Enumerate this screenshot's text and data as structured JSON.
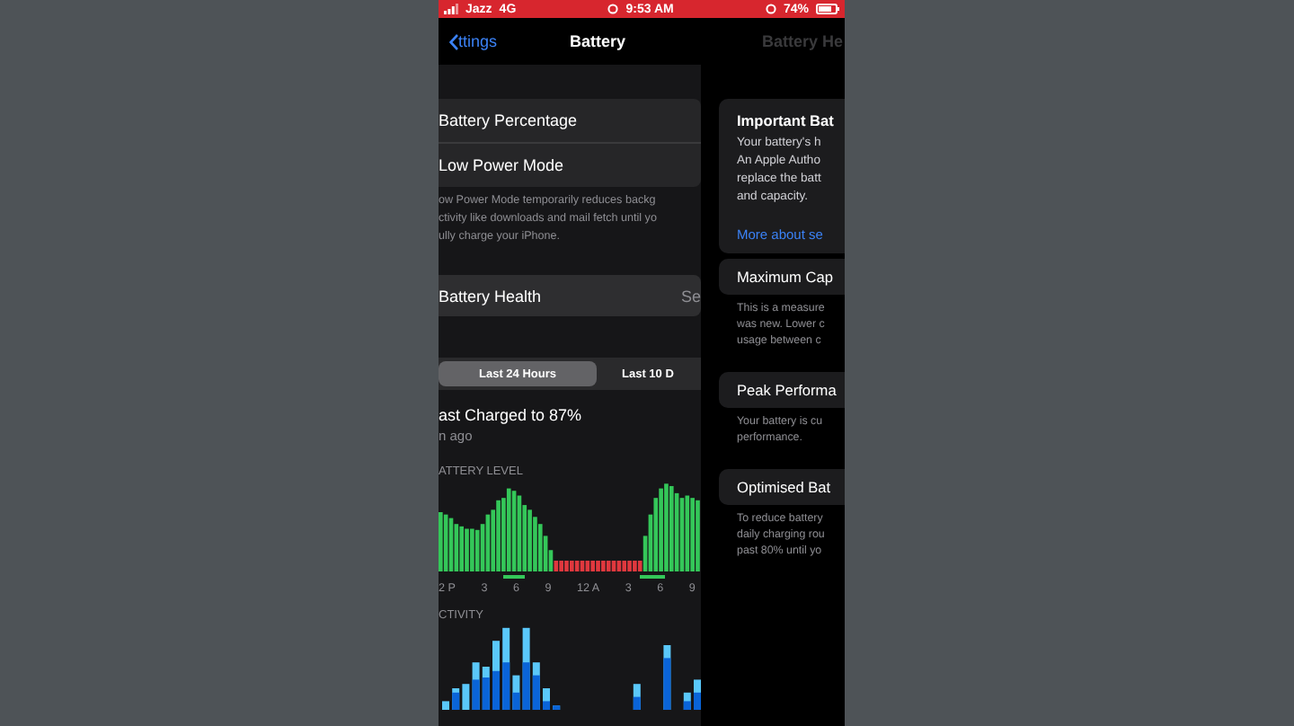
{
  "status_bar": {
    "carrier": "Jazz",
    "network": "4G",
    "time": "9:53 AM",
    "battery": "74%"
  },
  "nav": {
    "back": "ttings",
    "title": "Battery",
    "next_title": "Battery He"
  },
  "settings": [
    {
      "label": "Battery Percentage"
    },
    {
      "label": "Low Power Mode"
    }
  ],
  "low_power_note": "ow Power Mode temporarily reduces backg\nctivity like downloads and mail fetch until yo\nully charge your iPhone.",
  "battery_health": {
    "label": "Battery Health",
    "value": "Se"
  },
  "segments": [
    {
      "label": "Last 24 Hours",
      "selected": true
    },
    {
      "label": "Last 10 D",
      "selected": false
    }
  ],
  "last_charged": {
    "title": "ast Charged to 87%",
    "subtitle": "n ago"
  },
  "battery_level": {
    "heading": "ATTERY LEVEL",
    "x_labels": [
      "2 P",
      "3",
      "6",
      "9",
      "12 A",
      "3",
      "6",
      "9"
    ]
  },
  "activity": {
    "heading": "CTIVITY"
  },
  "health_panel": {
    "cards": [
      {
        "title": "Important Bat",
        "body": "Your battery's h\nAn Apple Autho\nreplace the batt\nand capacity.",
        "link": "More about se"
      },
      {
        "title": "Maximum Cap",
        "body": "This is a measure\nwas new. Lower c\nusage between c"
      },
      {
        "title": "Peak Performa",
        "body": "Your battery is cu\nperformance."
      },
      {
        "title": "Optimised Bat",
        "body": "To reduce battery\ndaily charging rou\npast 80% until yo"
      }
    ]
  }
}
